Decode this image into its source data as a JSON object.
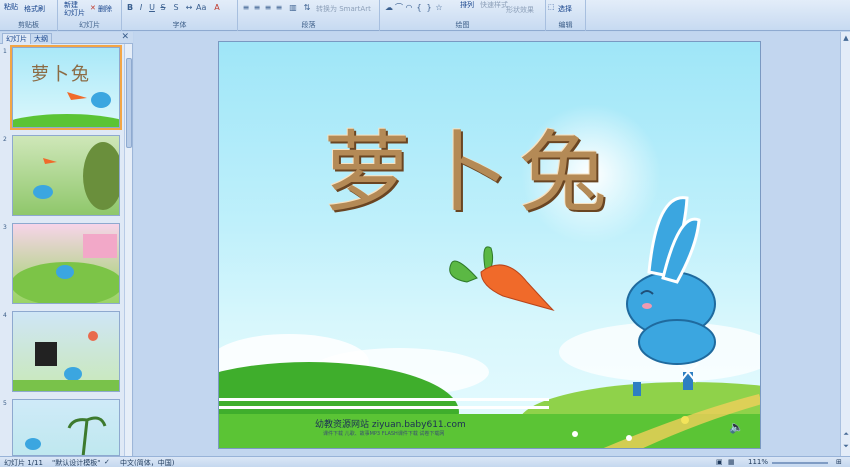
{
  "ribbon": {
    "clipboard": {
      "paste": "粘贴",
      "format_painter": "格式刷",
      "label": "剪贴板"
    },
    "slides": {
      "new_slide": "新建\n幻灯片",
      "delete": "删除",
      "label": "幻灯片"
    },
    "font": {
      "label": "字体"
    },
    "paragraph": {
      "convert_smartart": "转换为 SmartArt",
      "label": "段落"
    },
    "drawing": {
      "arrange": "排列",
      "quick_styles": "快速样式",
      "shape_effects": "形状效果",
      "label": "绘图"
    },
    "editing": {
      "select": "选择",
      "label": "编辑"
    }
  },
  "left_pane": {
    "tabs": [
      "幻灯片",
      "大纲"
    ],
    "slides": [
      {
        "num": "1",
        "title": "萝卜兔"
      },
      {
        "num": "2"
      },
      {
        "num": "3"
      },
      {
        "num": "4"
      },
      {
        "num": "5"
      }
    ]
  },
  "slide": {
    "title": "萝卜兔",
    "footer": "幼教资源网站  ziyuan.baby611.com",
    "footer_sub": "课件下载  儿歌、故事MP3  FLASH课件下载  试卷下载网"
  },
  "status": {
    "slide_info": "幻灯片 1/11",
    "theme": "\"默认设计模板\"",
    "language": "中文(简体，中国)",
    "zoom": "111%"
  },
  "colors": {
    "accent": "#f3a646",
    "sky": "#9fe6f8",
    "grass": "#5bc435",
    "rabbit": "#3ba6e0",
    "carrot": "#f06a2a"
  }
}
